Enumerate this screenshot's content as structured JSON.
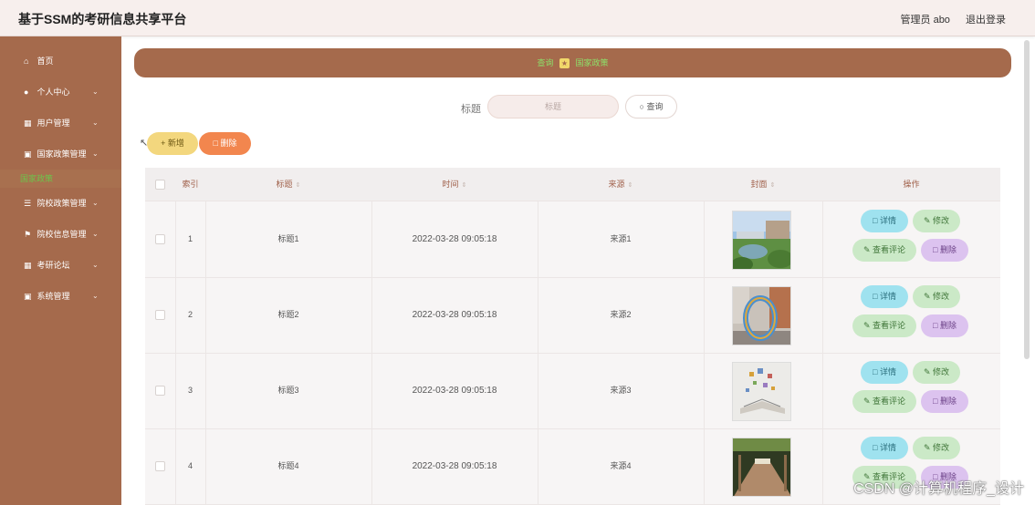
{
  "app": {
    "title": "基于SSM的考研信息共享平台"
  },
  "header": {
    "user_label": "管理员 abo",
    "logout_label": "退出登录"
  },
  "sidebar": {
    "items": [
      {
        "label": "首页",
        "icon": "home-icon",
        "has_children": false
      },
      {
        "label": "个人中心",
        "icon": "user-icon",
        "has_children": true
      },
      {
        "label": "用户管理",
        "icon": "grid-icon",
        "has_children": true
      },
      {
        "label": "国家政策管理",
        "icon": "monitor-icon",
        "has_children": true
      },
      {
        "label": "院校政策管理",
        "icon": "list-icon",
        "has_children": true
      },
      {
        "label": "院校信息管理",
        "icon": "flag-icon",
        "has_children": true
      },
      {
        "label": "考研论坛",
        "icon": "grid-icon",
        "has_children": true
      },
      {
        "label": "系统管理",
        "icon": "monitor-icon",
        "has_children": true
      }
    ],
    "active_sub": "国家政策"
  },
  "breadcrumb": {
    "first": "查询",
    "second": "国家政策"
  },
  "search": {
    "label": "标题",
    "placeholder": "标题",
    "button": "查询"
  },
  "toolbar": {
    "add_label": "+ 新增",
    "delete_label": "删除"
  },
  "table": {
    "columns": [
      "索引",
      "标题",
      "时间",
      "来源",
      "封面",
      "操作"
    ],
    "rows": [
      {
        "index": "1",
        "title": "标题1",
        "time": "2022-03-28 09:05:18",
        "source": "来源1"
      },
      {
        "index": "2",
        "title": "标题2",
        "time": "2022-03-28 09:05:18",
        "source": "来源2"
      },
      {
        "index": "3",
        "title": "标题3",
        "time": "2022-03-28 09:05:18",
        "source": "来源3"
      },
      {
        "index": "4",
        "title": "标题4",
        "time": "2022-03-28 09:05:18",
        "source": "来源4"
      }
    ],
    "actions": {
      "detail": "详情",
      "edit": "修改",
      "review": "查看评论",
      "delete": "删除"
    }
  },
  "watermark": "CSDN @计算机程序_设计",
  "colors": {
    "sidebar": "#a56a4c",
    "header": "#f7efed",
    "add": "#f3d77e",
    "delete": "#f2864e"
  }
}
